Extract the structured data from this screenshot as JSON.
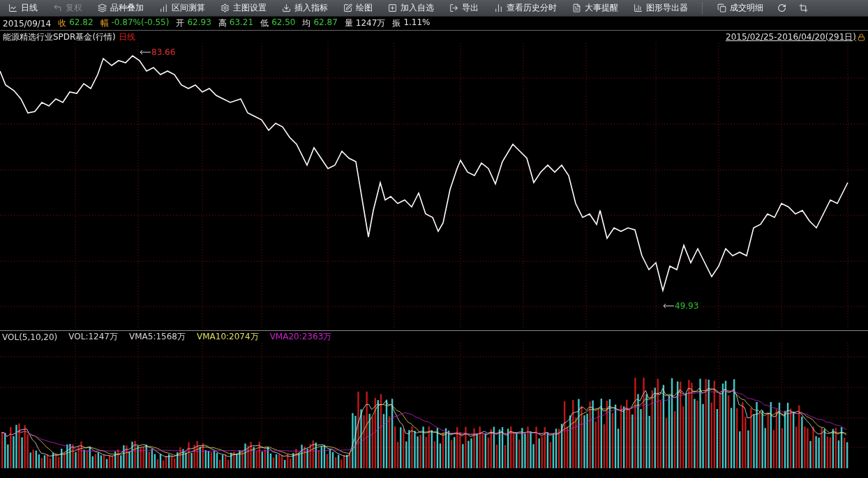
{
  "toolbar": {
    "items": [
      {
        "label": "日线",
        "disabled": false
      },
      {
        "label": "复权",
        "disabled": true
      },
      {
        "label": "品种叠加",
        "disabled": false
      },
      {
        "label": "区间测算",
        "disabled": false
      },
      {
        "label": "主图设置",
        "disabled": false
      },
      {
        "label": "插入指标",
        "disabled": false
      },
      {
        "label": "绘图",
        "disabled": false
      },
      {
        "label": "加入自选",
        "disabled": false
      },
      {
        "label": "导出",
        "disabled": false
      },
      {
        "label": "查看历史分时",
        "disabled": false
      },
      {
        "label": "大事提醒",
        "disabled": false
      },
      {
        "label": "图形导出器",
        "disabled": false
      },
      {
        "label": "成交明细",
        "disabled": false
      }
    ]
  },
  "quote": {
    "date": "2015/09/14",
    "fields": [
      {
        "label": "收",
        "value": "62.82",
        "kind": "change"
      },
      {
        "label": "幅",
        "value": "-0.87%(-0.55)",
        "kind": "change"
      },
      {
        "label": "开",
        "value": "62.93",
        "kind": "price"
      },
      {
        "label": "高",
        "value": "63.21",
        "kind": "price"
      },
      {
        "label": "低",
        "value": "62.50",
        "kind": "price"
      },
      {
        "label": "均",
        "value": "62.87",
        "kind": "price"
      },
      {
        "label": "量",
        "value": "1247万",
        "kind": "amount"
      },
      {
        "label": "振",
        "value": "1.11%",
        "kind": "amount"
      }
    ]
  },
  "price_chart": {
    "name": "能源精选行业SPDR基金(行情)",
    "period": "日线",
    "range": "2015/02/25-2016/04/20(291日)",
    "high_marker": "83.66",
    "low_marker": "49.93"
  },
  "volume_chart": {
    "legend": [
      {
        "text": "VOL(5,10,20)",
        "color": "#d8d8d8"
      },
      {
        "text": "VOL:1247万",
        "color": "#d8d8d8"
      },
      {
        "text": "VMA5:1568万",
        "color": "#d8d8d8"
      },
      {
        "text": "VMA10:2074万",
        "color": "#e0e060"
      },
      {
        "text": "VMA20:2363万",
        "color": "#d020d0"
      }
    ]
  }
}
